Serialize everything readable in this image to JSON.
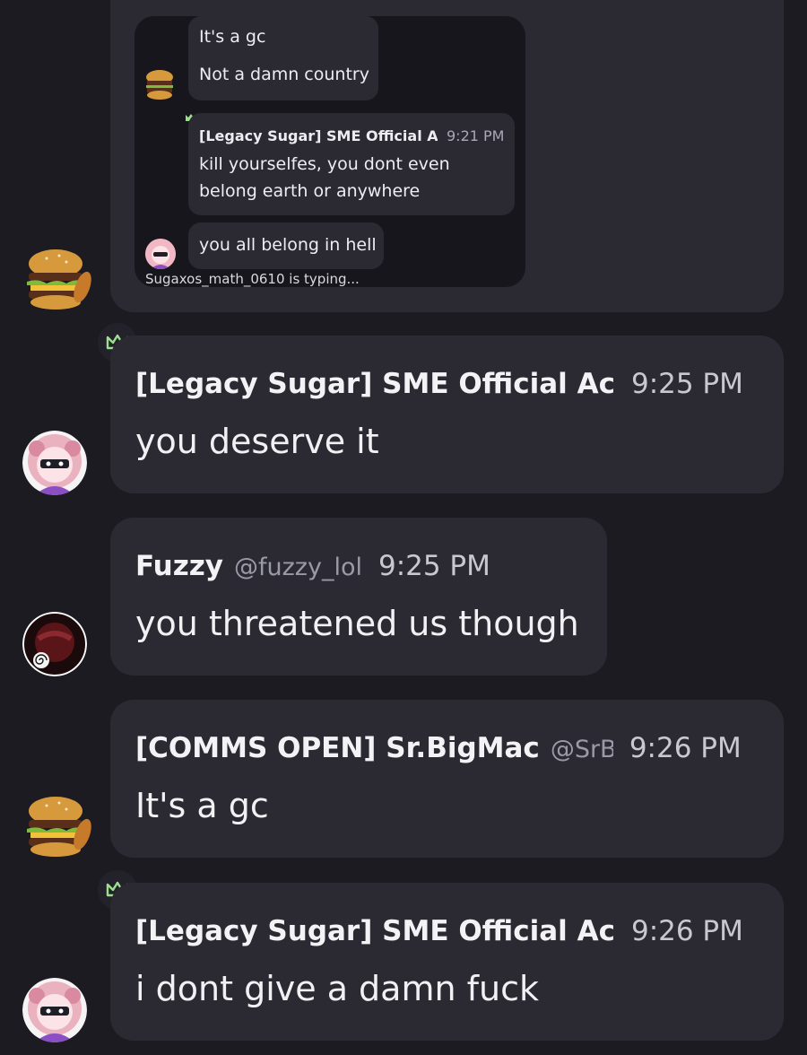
{
  "embed": {
    "line1": "It's a gc",
    "line2": "Not a damn country",
    "msg_name": "[Legacy Sugar] SME Official Ac",
    "msg_time": "9:21 PM",
    "msg_line1": "kill yourselfes, you dont even",
    "msg_line2": "belong earth or anywhere",
    "last_line": "you all belong in hell",
    "typing": "Sugaxos_math_0610 is typing..."
  },
  "messages": [
    {
      "name": "[Legacy Sugar] SME Official Ac",
      "handle": "",
      "time": "9:25 PM",
      "text": "you deserve it"
    },
    {
      "name": "Fuzzy",
      "handle": "@fuzzy_lol",
      "time": "9:25 PM",
      "text": "you threatened us though"
    },
    {
      "name": "[COMMS OPEN] Sr.BigMac",
      "handle": "@SrB",
      "time": "9:26 PM",
      "text": "It's a gc"
    },
    {
      "name": "[Legacy Sugar] SME Official Ac",
      "handle": "",
      "time": "9:26 PM",
      "text": "i dont give a damn fuck"
    }
  ],
  "colors": {
    "background": "#1c1b22",
    "bubble": "#2b2a33",
    "crown": "#9be08a"
  }
}
